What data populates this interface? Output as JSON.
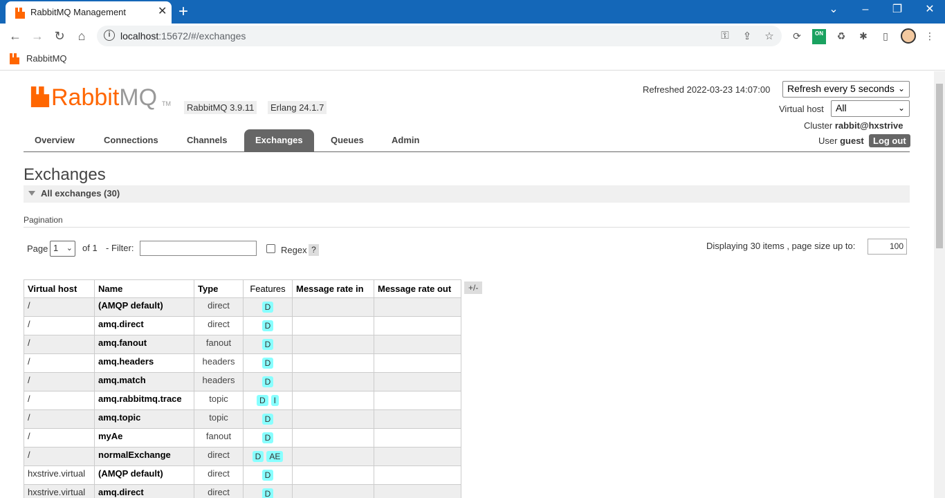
{
  "browser": {
    "tab_title": "RabbitMQ Management",
    "url_host": "localhost",
    "url_rest": ":15672/#/exchanges",
    "bookmark": "RabbitMQ",
    "ext_badge": "ON"
  },
  "header": {
    "logo_main": "Rabbit",
    "logo_mq": "MQ",
    "logo_tm": "TM",
    "rabbit_version": "RabbitMQ 3.9.11",
    "erlang_version": "Erlang 24.1.7",
    "refreshed_label": "Refreshed 2022-03-23 14:07:00",
    "refresh_select": "Refresh every 5 seconds",
    "vhost_label": "Virtual host",
    "vhost_select": "All",
    "cluster_label": "Cluster",
    "cluster_value": "rabbit@hxstrive",
    "user_label": "User",
    "user_value": "guest",
    "logout": "Log out"
  },
  "nav": {
    "tabs": [
      "Overview",
      "Connections",
      "Channels",
      "Exchanges",
      "Queues",
      "Admin"
    ],
    "active": "Exchanges"
  },
  "main": {
    "title": "Exchanges",
    "section": "All exchanges (30)",
    "pagination_label": "Pagination",
    "page_label": "Page",
    "page_value": "1",
    "of_label": "of 1",
    "filter_label": "- Filter:",
    "filter_value": "",
    "regex_label": "Regex",
    "help": "?",
    "displaying": "Displaying 30 items , page size up to:",
    "page_size": "100",
    "toggle_columns": "+/-"
  },
  "table": {
    "headers": [
      "Virtual host",
      "Name",
      "Type",
      "Features",
      "Message rate in",
      "Message rate out"
    ],
    "rows": [
      {
        "vhost": "/",
        "name": "(AMQP default)",
        "type": "direct",
        "features": [
          "D"
        ],
        "rate_in": "",
        "rate_out": ""
      },
      {
        "vhost": "/",
        "name": "amq.direct",
        "type": "direct",
        "features": [
          "D"
        ],
        "rate_in": "",
        "rate_out": ""
      },
      {
        "vhost": "/",
        "name": "amq.fanout",
        "type": "fanout",
        "features": [
          "D"
        ],
        "rate_in": "",
        "rate_out": ""
      },
      {
        "vhost": "/",
        "name": "amq.headers",
        "type": "headers",
        "features": [
          "D"
        ],
        "rate_in": "",
        "rate_out": ""
      },
      {
        "vhost": "/",
        "name": "amq.match",
        "type": "headers",
        "features": [
          "D"
        ],
        "rate_in": "",
        "rate_out": ""
      },
      {
        "vhost": "/",
        "name": "amq.rabbitmq.trace",
        "type": "topic",
        "features": [
          "D",
          "I"
        ],
        "rate_in": "",
        "rate_out": ""
      },
      {
        "vhost": "/",
        "name": "amq.topic",
        "type": "topic",
        "features": [
          "D"
        ],
        "rate_in": "",
        "rate_out": ""
      },
      {
        "vhost": "/",
        "name": "myAe",
        "type": "fanout",
        "features": [
          "D"
        ],
        "rate_in": "",
        "rate_out": ""
      },
      {
        "vhost": "/",
        "name": "normalExchange",
        "type": "direct",
        "features": [
          "D",
          "AE"
        ],
        "rate_in": "",
        "rate_out": ""
      },
      {
        "vhost": "hxstrive.virtual",
        "name": "(AMQP default)",
        "type": "direct",
        "features": [
          "D"
        ],
        "rate_in": "",
        "rate_out": ""
      },
      {
        "vhost": "hxstrive.virtual",
        "name": "amq.direct",
        "type": "direct",
        "features": [
          "D"
        ],
        "rate_in": "",
        "rate_out": ""
      }
    ]
  }
}
